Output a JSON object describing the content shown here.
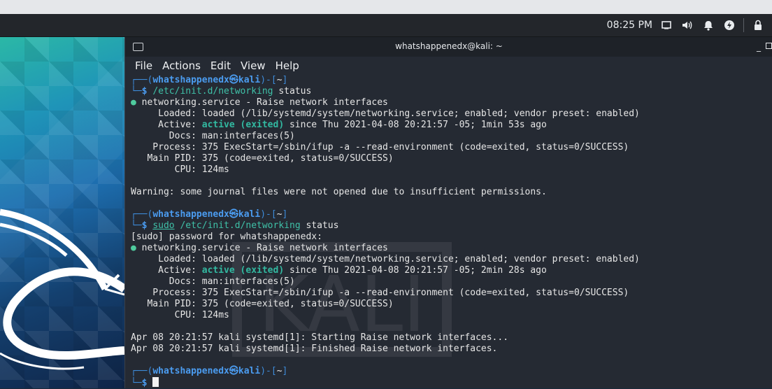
{
  "panel": {
    "time": "08:25 PM",
    "icons": [
      "window-icon",
      "volume-icon",
      "bell-icon",
      "power-icon",
      "lock-icon"
    ]
  },
  "window": {
    "title": "whatshappenedx@kali: ~"
  },
  "menu": [
    "File",
    "Actions",
    "Edit",
    "View",
    "Help"
  ],
  "prompt": {
    "user": "whatshappenedx",
    "at": "㉿",
    "host": "kali",
    "dir": "~",
    "symbol": "$"
  },
  "session1": {
    "command": "/etc/init.d/networking",
    "arg": "status",
    "service": "networking.service - Raise network interfaces",
    "loaded": "loaded (/lib/systemd/system/networking.service; enabled; vendor preset: enabled)",
    "active_state": "active (exited)",
    "active_rest": " since Thu 2021-04-08 20:21:57 -05; 1min 53s ago",
    "docs": "man:interfaces(5)",
    "process": "375 ExecStart=/sbin/ifup -a --read-environment (code=exited, status=0/SUCCESS)",
    "main_pid": "375 (code=exited, status=0/SUCCESS)",
    "cpu": "124ms",
    "warning": "Warning: some journal files were not opened due to insufficient permissions."
  },
  "session2": {
    "sudo": "sudo",
    "command": "/etc/init.d/networking",
    "arg": "status",
    "password_prompt": "[sudo] password for whatshappenedx:",
    "service": "networking.service - Raise network interfaces",
    "loaded": "loaded (/lib/systemd/system/networking.service; enabled; vendor preset: enabled)",
    "active_state": "active (exited)",
    "active_rest": " since Thu 2021-04-08 20:21:57 -05; 2min 28s ago",
    "docs": "man:interfaces(5)",
    "process": "375 ExecStart=/sbin/ifup -a --read-environment (code=exited, status=0/SUCCESS)",
    "main_pid": "375 (code=exited, status=0/SUCCESS)",
    "cpu": "124ms",
    "log1": "Apr 08 20:21:57 kali systemd[1]: Starting Raise network interfaces...",
    "log2": "Apr 08 20:21:57 kali systemd[1]: Finished Raise network interfaces."
  },
  "labels": {
    "loaded": "     Loaded: ",
    "active": "     Active: ",
    "docs": "       Docs: ",
    "process": "    Process: ",
    "main_pid": "   Main PID: ",
    "cpu": "        CPU: "
  }
}
